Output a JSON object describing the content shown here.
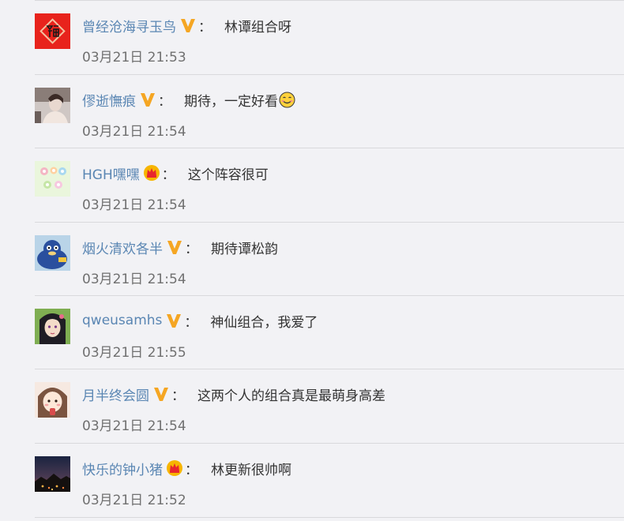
{
  "comments": [
    {
      "username": "曾经沧海寻玉鸟",
      "badge": "v-badge-icon",
      "text": "林谭组合呀",
      "time": "03月21日 21:53",
      "avatar": "fu-character-red"
    },
    {
      "username": "僇逝憮痕",
      "badge": "v-badge-icon",
      "text": "期待，一定好看",
      "emoji": "smile-emoji-icon",
      "time": "03月21日 21:54",
      "avatar": "photo-portrait"
    },
    {
      "username": "HGH嘿嘿",
      "badge": "crown-badge-icon",
      "text": "这个阵容很可",
      "time": "03月21日 21:54",
      "avatar": "colorful-text-avatar"
    },
    {
      "username": "烟火清欢各半",
      "badge": "v-badge-icon",
      "text": "期待谭松韵",
      "time": "03月21日 21:54",
      "avatar": "cartoon-blue-character"
    },
    {
      "username": "qweusamhs",
      "badge": "v-badge-icon",
      "text": "神仙组合，我爱了",
      "time": "03月21日 21:55",
      "avatar": "anime-girl"
    },
    {
      "username": "月半终会圆",
      "badge": "v-badge-icon",
      "text": "这两个人的组合真是最萌身高差",
      "time": "03月21日 21:54",
      "avatar": "cartoon-girl"
    },
    {
      "username": "快乐的钟小猪",
      "badge": "crown-badge-icon",
      "text": "林更新很帅啊",
      "time": "03月21日 21:52",
      "avatar": "night-landscape"
    }
  ],
  "colors": {
    "background": "#f2f2f5",
    "username": "#5a86b3",
    "text": "#333333",
    "time": "#707070",
    "separator": "#d9d9dc",
    "v_badge": "#f5a623",
    "crown_badge": "#f7b500"
  }
}
